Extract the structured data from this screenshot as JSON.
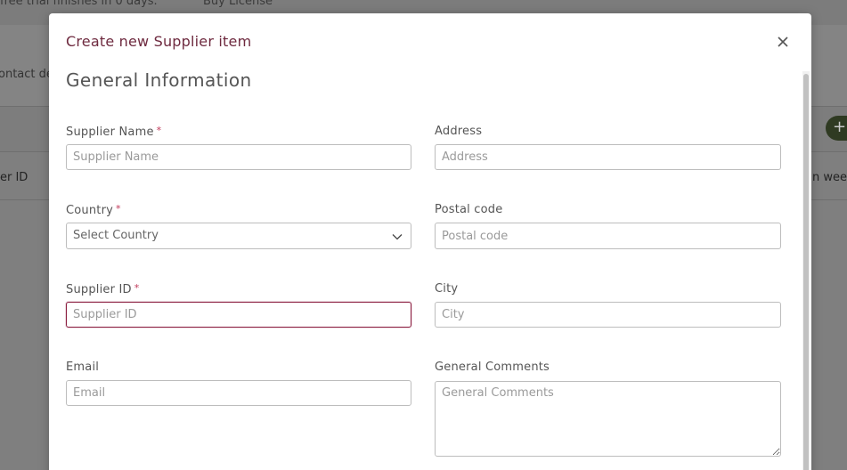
{
  "background": {
    "top_text_1": "free trial finishes in 0 days.",
    "top_text_2": "Buy License",
    "contact_text": "ontact de",
    "col_left": "er ID",
    "col_right": "n wee",
    "add_button": "+"
  },
  "modal": {
    "title": "Create new Supplier item",
    "close_label": "×",
    "section_title": "General Information",
    "required_marker": "*",
    "fields": {
      "supplier_name": {
        "label": "Supplier Name",
        "placeholder": "Supplier Name",
        "value": ""
      },
      "address": {
        "label": "Address",
        "placeholder": "Address",
        "value": ""
      },
      "country": {
        "label": "Country",
        "selected": "Select Country"
      },
      "postal_code": {
        "label": "Postal code",
        "placeholder": "Postal code",
        "value": ""
      },
      "supplier_id": {
        "label": "Supplier ID",
        "placeholder": "Supplier ID",
        "value": ""
      },
      "city": {
        "label": "City",
        "placeholder": "City",
        "value": ""
      },
      "email": {
        "label": "Email",
        "placeholder": "Email",
        "value": ""
      },
      "general_comments": {
        "label": "General Comments",
        "placeholder": "General Comments",
        "value": ""
      }
    }
  },
  "colors": {
    "accent": "#8b1e40",
    "title": "#6e2a3f",
    "required": "#c0395a",
    "overlay": "#7f7f7f"
  }
}
